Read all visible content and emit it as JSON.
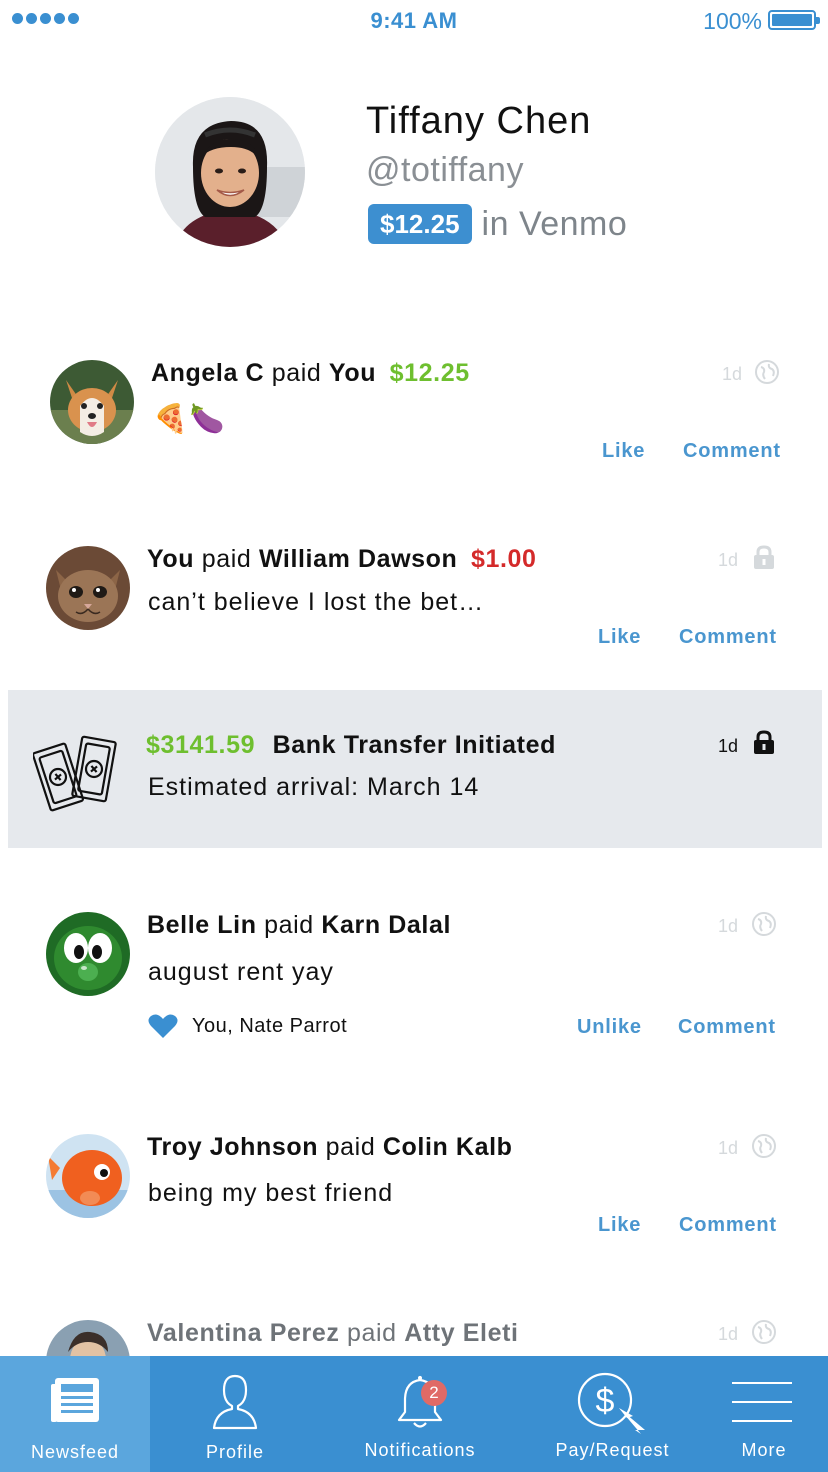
{
  "status_bar": {
    "time": "9:41 AM",
    "battery": "100%"
  },
  "profile": {
    "name": "Tiffany Chen",
    "handle": "@totiffany",
    "balance": "$12.25",
    "balance_suffix": "in Venmo"
  },
  "feed": [
    {
      "actor": "Angela C",
      "verb": "paid",
      "target": "You",
      "amount": "$12.25",
      "amount_type": "positive",
      "note": "🍕🍆",
      "time": "1d",
      "privacy": "globe-icon",
      "actions": {
        "like": "Like",
        "comment": "Comment"
      }
    },
    {
      "actor": "You",
      "verb": "paid",
      "target": "William Dawson",
      "amount": "$1.00",
      "amount_type": "negative",
      "note": "can’t believe I lost the bet…",
      "time": "1d",
      "privacy": "lock-icon",
      "actions": {
        "like": "Like",
        "comment": "Comment"
      }
    },
    {
      "type": "bank-transfer",
      "amount": "$3141.59",
      "title": "Bank Transfer Initiated",
      "note": "Estimated arrival: March 14",
      "time": "1d",
      "privacy": "lock-icon"
    },
    {
      "actor": "Belle Lin",
      "verb": "paid",
      "target": "Karn Dalal",
      "note": "august rent yay",
      "time": "1d",
      "privacy": "globe-icon",
      "likes": "You, Nate Parrot",
      "actions": {
        "like": "Unlike",
        "comment": "Comment"
      }
    },
    {
      "actor": "Troy Johnson",
      "verb": "paid",
      "target": "Colin Kalb",
      "note": "being my best friend",
      "time": "1d",
      "privacy": "globe-icon",
      "actions": {
        "like": "Like",
        "comment": "Comment"
      }
    },
    {
      "actor": "Valentina Perez",
      "verb": "paid",
      "target": "Atty Eleti",
      "time": "1d",
      "privacy": "globe-icon"
    }
  ],
  "tabs": [
    {
      "label": "Newsfeed",
      "icon": "newspaper-icon",
      "active": true
    },
    {
      "label": "Profile",
      "icon": "person-icon"
    },
    {
      "label": "Notifications",
      "icon": "bell-icon",
      "badge": "2"
    },
    {
      "label": "Pay/Request",
      "icon": "dollar-cursor-icon"
    },
    {
      "label": "More",
      "icon": "menu-icon"
    }
  ],
  "colors": {
    "brand_blue": "#3a8fd1",
    "positive_amount": "#6ebf2f",
    "negative_amount": "#d42a2a",
    "action_link": "#4a96cf",
    "badge": "#e06a66"
  }
}
